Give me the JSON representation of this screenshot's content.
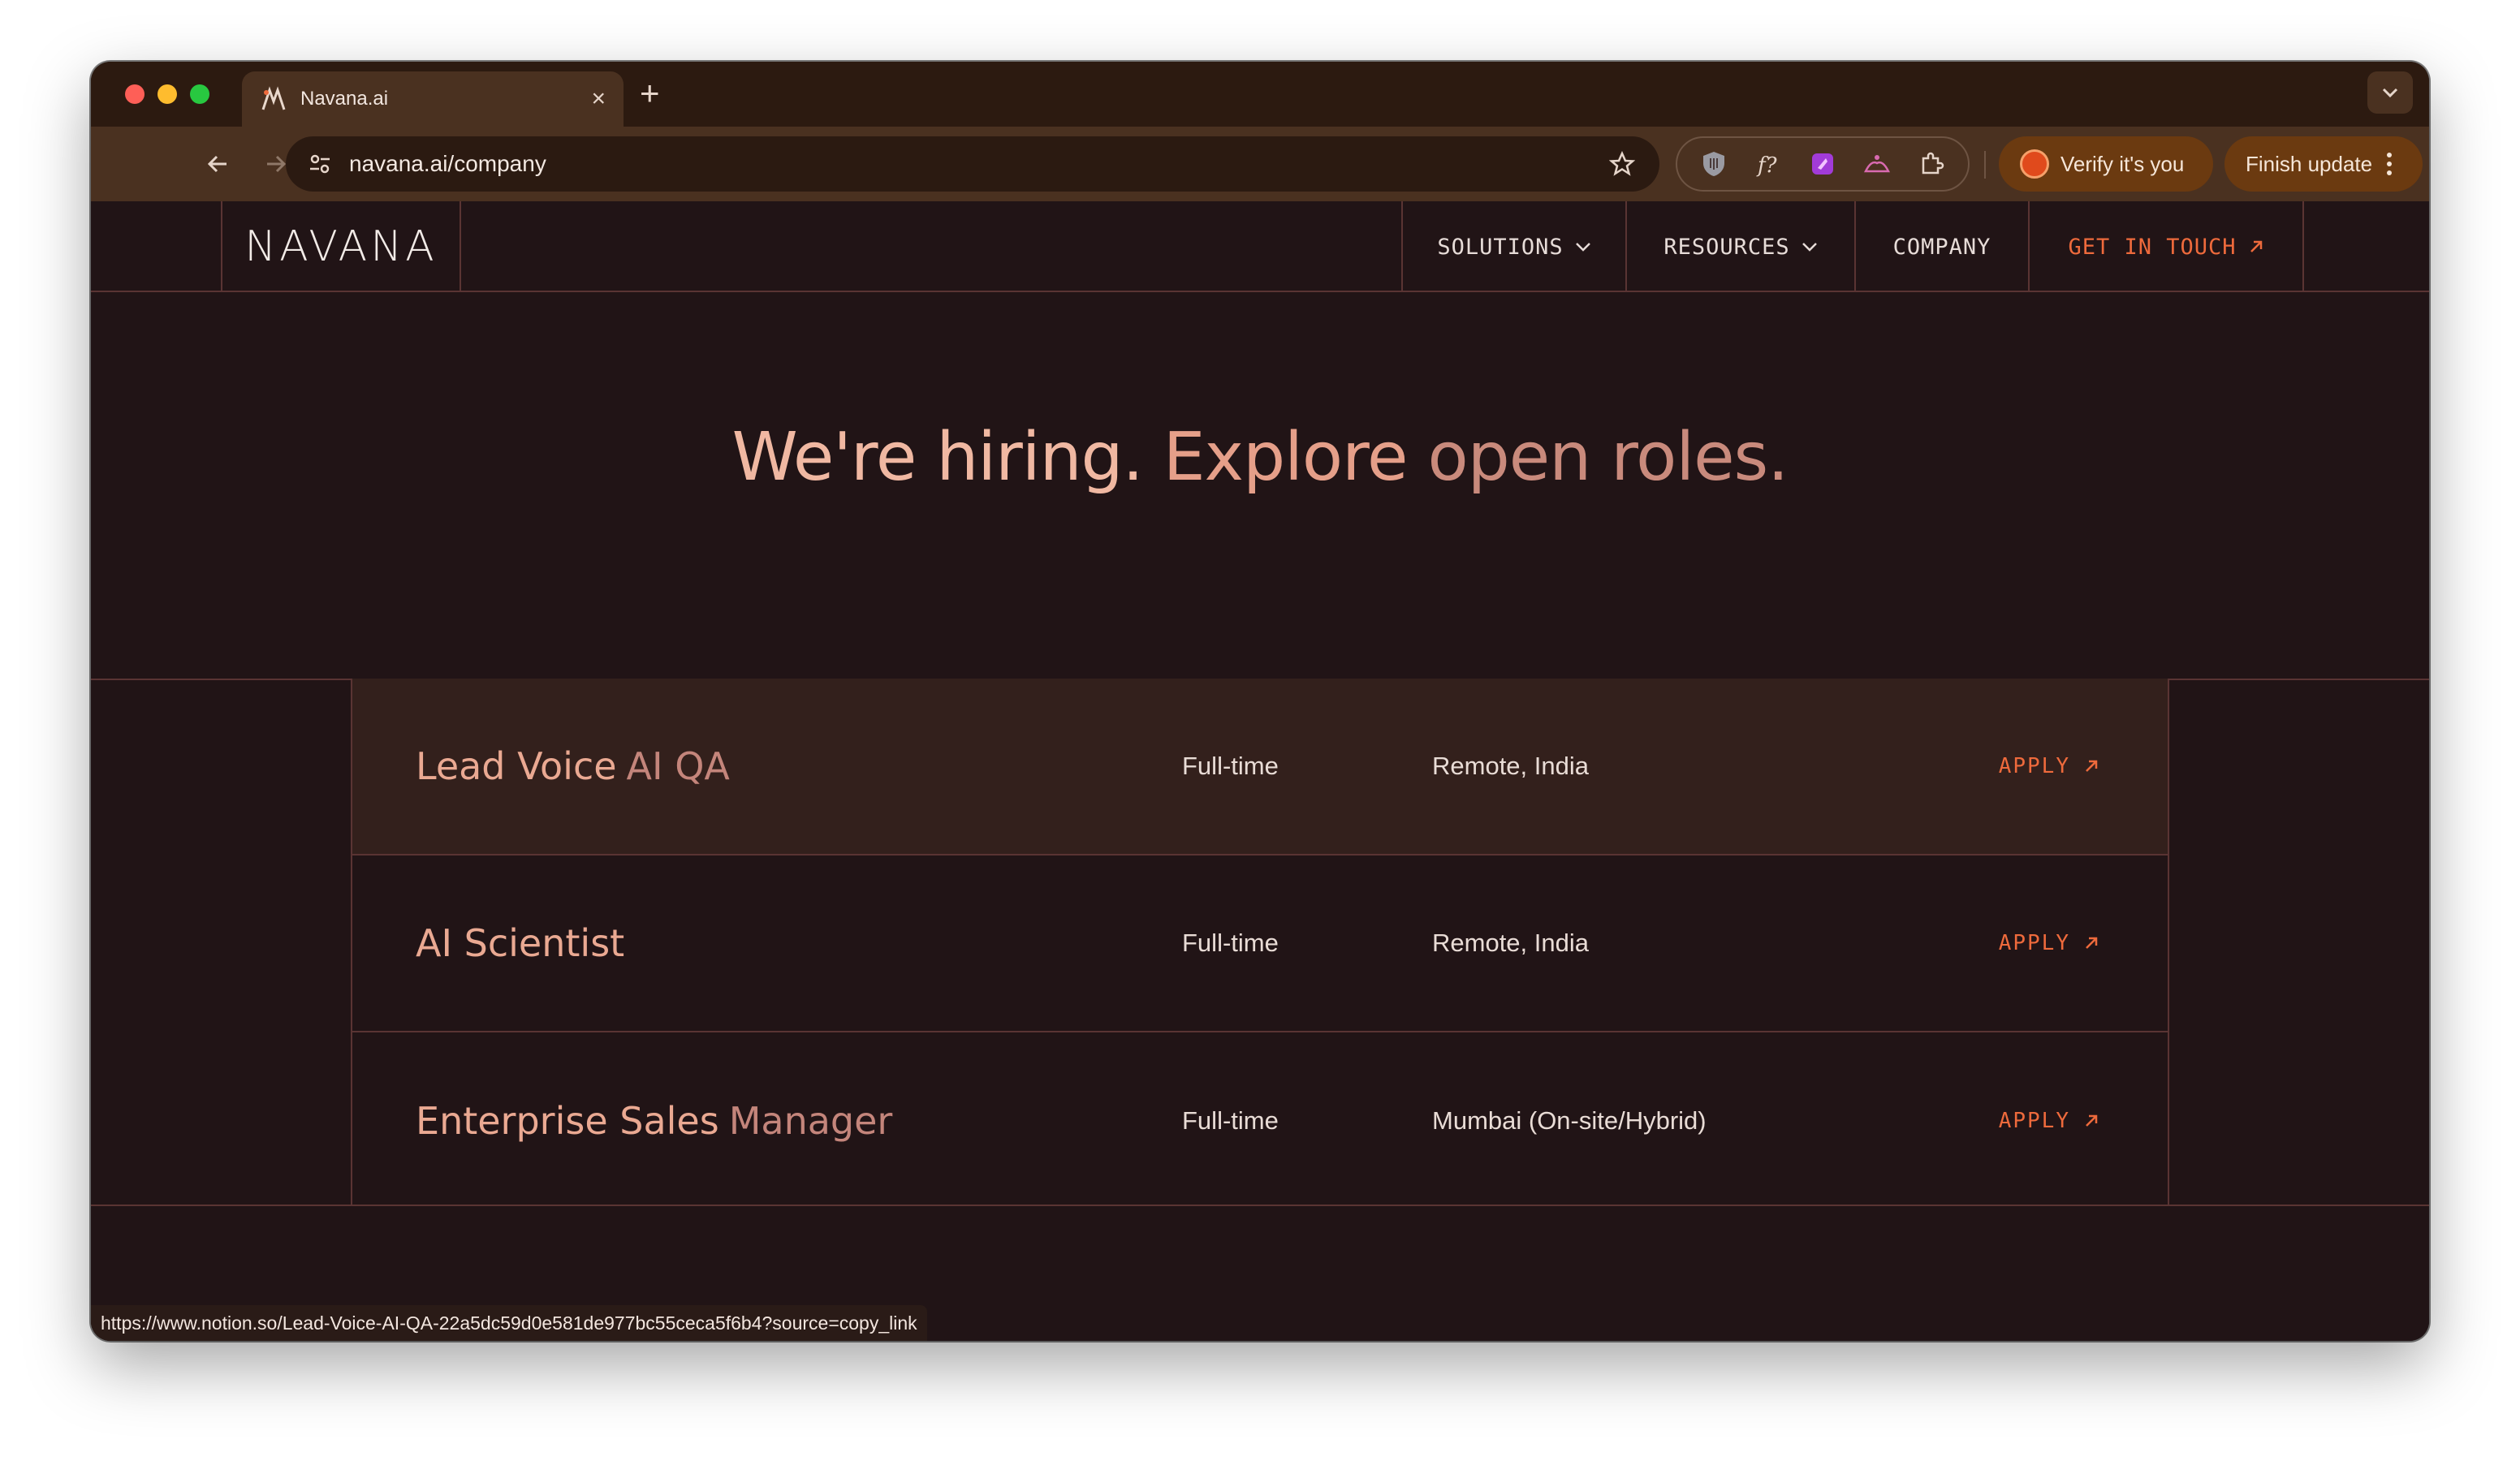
{
  "browser": {
    "tab_title": "Navana.ai",
    "url": "navana.ai/company",
    "verify_label": "Verify it's you",
    "finish_update_label": "Finish update",
    "status_url": "https://www.notion.so/Lead-Voice-AI-QA-22a5dc59d0e581de977bc55ceca5f6b4?source=copy_link"
  },
  "site": {
    "logo": "NAVANA",
    "nav": {
      "solutions": "SOLUTIONS",
      "resources": "RESOURCES",
      "company": "COMPANY",
      "contact": "GET IN TOUCH"
    }
  },
  "hero": {
    "part_a": "We're hiring.",
    "part_b": "Explore",
    "part_c": "open roles."
  },
  "roles": [
    {
      "title_main": "Lead Voice",
      "title_accent": "AI QA",
      "type": "Full-time",
      "location": "Remote, India",
      "apply": "APPLY"
    },
    {
      "title_main": "AI Scientist",
      "title_accent": "",
      "type": "Full-time",
      "location": "Remote, India",
      "apply": "APPLY"
    },
    {
      "title_main": "Enterprise Sales",
      "title_accent": "Manager",
      "type": "Full-time",
      "location": "Mumbai (On-site/Hybrid)",
      "apply": "APPLY"
    }
  ],
  "colors": {
    "page_bg": "#211416",
    "accent": "#ee6a3c",
    "heading": "#f0b8a2",
    "divider": "#5a3433"
  }
}
